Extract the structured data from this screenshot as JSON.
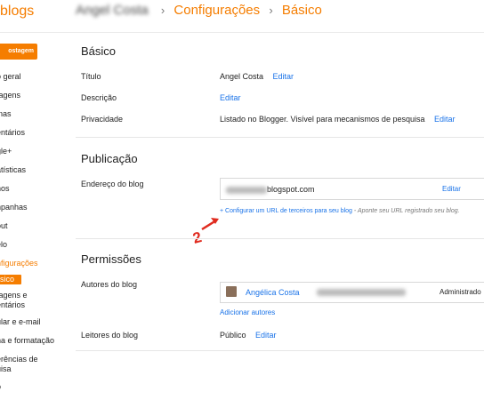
{
  "topbar": {
    "brand": "blogs",
    "owner_name": "Angel Costa",
    "breadcrumb_settings": "Configurações",
    "breadcrumb_basic": "Básico",
    "separator": "›"
  },
  "sidebar": {
    "new_post_label": "ostagem",
    "items": [
      "o geral",
      "tagens",
      "inas",
      "entários",
      "gle+",
      "atísticas",
      "hos",
      "npanhas",
      "out",
      "elo",
      "nfigurações",
      "sico",
      "tagens e",
      "entários",
      "ular e e-mail",
      "na e formatação",
      "erências de",
      "uisa",
      "o"
    ]
  },
  "basic": {
    "title": "Básico",
    "title_label": "Título",
    "title_value": "Angel Costa",
    "title_edit": "Editar",
    "description_label": "Descrição",
    "description_edit": "Editar",
    "privacy_label": "Privacidade",
    "privacy_value": "Listado no Blogger. Visível para mecanismos de pesquisa",
    "privacy_edit": "Editar"
  },
  "publishing": {
    "title": "Publicação",
    "address_label": "Endereço do blog",
    "address_suffix": "blogspot.com",
    "address_edit": "Editar",
    "configure_link": "+ Configurar um URL de terceiros para seu blog",
    "configure_hint": " - Aponte seu URL registrado seu blog.",
    "annotation_number": "2"
  },
  "permissions": {
    "title": "Permissões",
    "authors_label": "Autores do blog",
    "author_name": "Angélica Costa",
    "author_role": "Administrado",
    "add_authors": "Adicionar autores",
    "readers_label": "Leitores do blog",
    "readers_value": "Público",
    "readers_edit": "Editar"
  },
  "colors": {
    "accent": "#f57d00",
    "link": "#1a73e8",
    "annotation": "#e02b1f"
  }
}
